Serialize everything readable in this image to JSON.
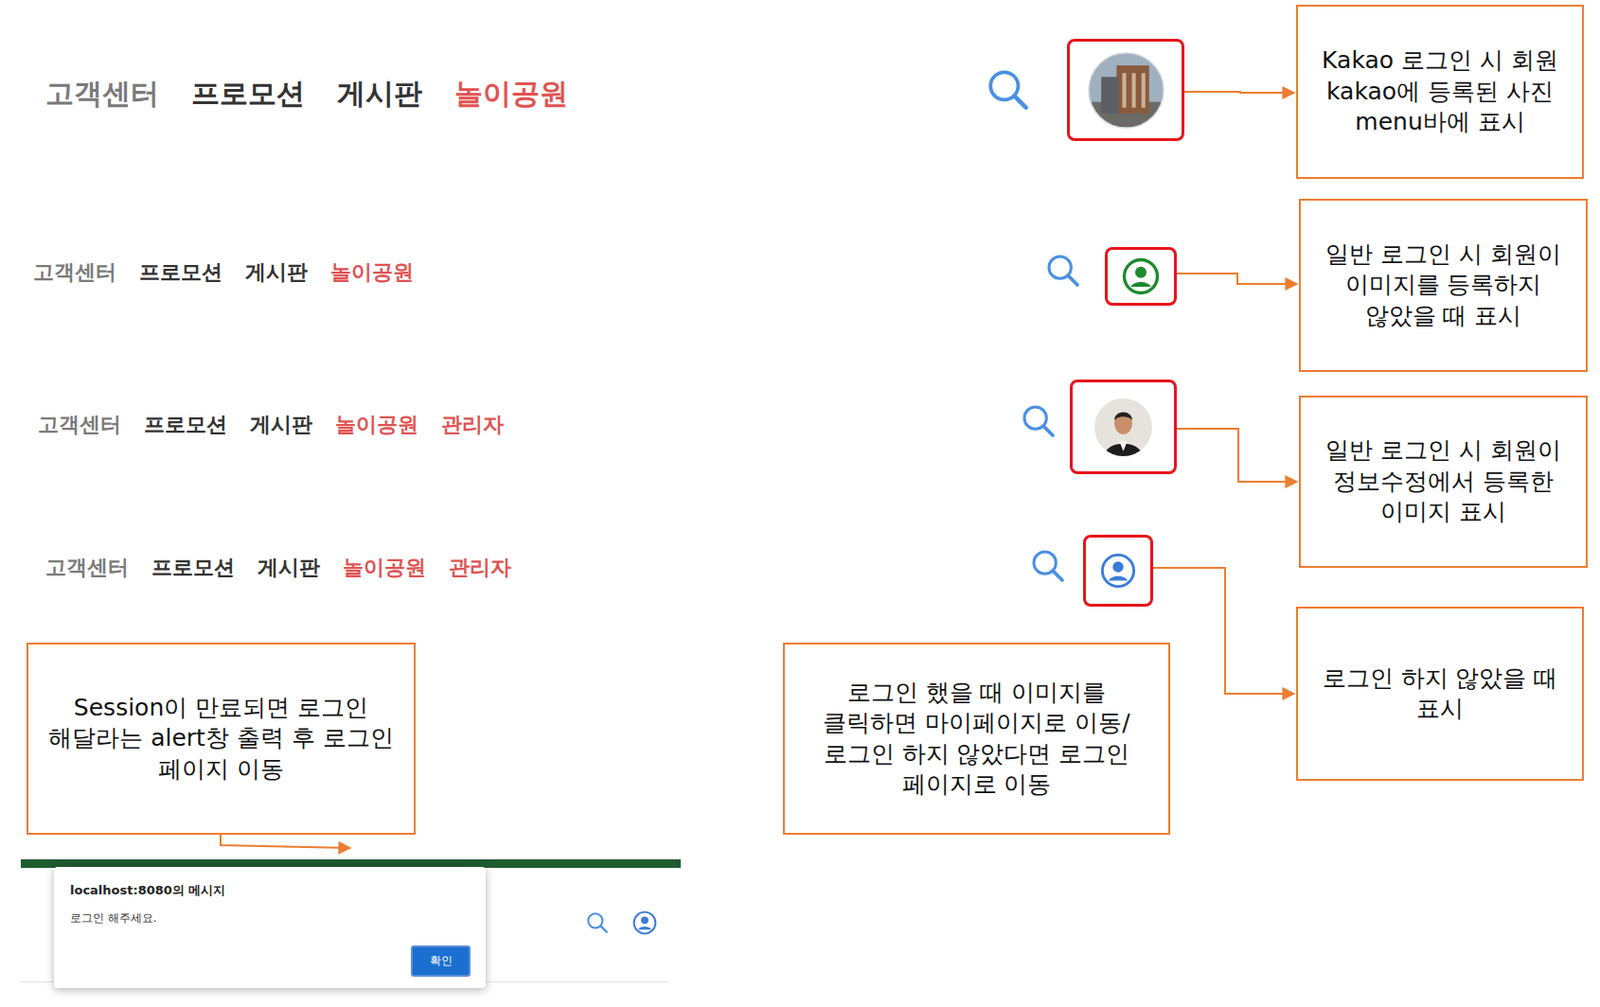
{
  "nav_rows": [
    {
      "kind": "large",
      "items": [
        {
          "label": "고객센터",
          "color": "#7a7a7a"
        },
        {
          "label": "프로모션",
          "color": "#333333"
        },
        {
          "label": "게시판",
          "color": "#333333"
        },
        {
          "label": "놀이공원",
          "color": "#e05353"
        }
      ]
    },
    {
      "kind": "small",
      "items": [
        {
          "label": "고객센터",
          "color": "#7a7a7a"
        },
        {
          "label": "프로모션",
          "color": "#333333"
        },
        {
          "label": "게시판",
          "color": "#333333"
        },
        {
          "label": "놀이공원",
          "color": "#e05353"
        }
      ]
    },
    {
      "kind": "small",
      "items": [
        {
          "label": "고객센터",
          "color": "#7a7a7a"
        },
        {
          "label": "프로모션",
          "color": "#333333"
        },
        {
          "label": "게시판",
          "color": "#333333"
        },
        {
          "label": "놀이공원",
          "color": "#e05353"
        },
        {
          "label": "관리자",
          "color": "#e05353"
        }
      ]
    },
    {
      "kind": "small",
      "items": [
        {
          "label": "고객센터",
          "color": "#7a7a7a"
        },
        {
          "label": "프로모션",
          "color": "#333333"
        },
        {
          "label": "게시판",
          "color": "#333333"
        },
        {
          "label": "놀이공원",
          "color": "#e05353"
        },
        {
          "label": "관리자",
          "color": "#e05353"
        }
      ]
    }
  ],
  "profile_states": [
    {
      "kind": "kakao-photo",
      "annotation": "Kakao 로그인 시 회원 kakao에 등록된 사진 menu바에 표시"
    },
    {
      "kind": "default-green",
      "annotation": "일반 로그인 시 회원이 이미지를 등록하지 않았을 때 표시"
    },
    {
      "kind": "uploaded-photo",
      "annotation": "일반 로그인 시 회원이 정보수정에서 등록한 이미지 표시"
    },
    {
      "kind": "guest",
      "annotation": "로그인 하지 않았을 때 표시"
    }
  ],
  "click_note": "로그인 했을 때 이미지를 클릭하면 마이페이지로 이동/ 로그인 하지 않았다면 로그인 페이지로 이동",
  "session_note": "Session이 만료되면 로그인 해달라는 alert창 출력 후 로그인 페이지 이동",
  "alert": {
    "origin": "localhost:8080의 메시지",
    "message": "로그인 해주세요.",
    "button": "확인"
  }
}
